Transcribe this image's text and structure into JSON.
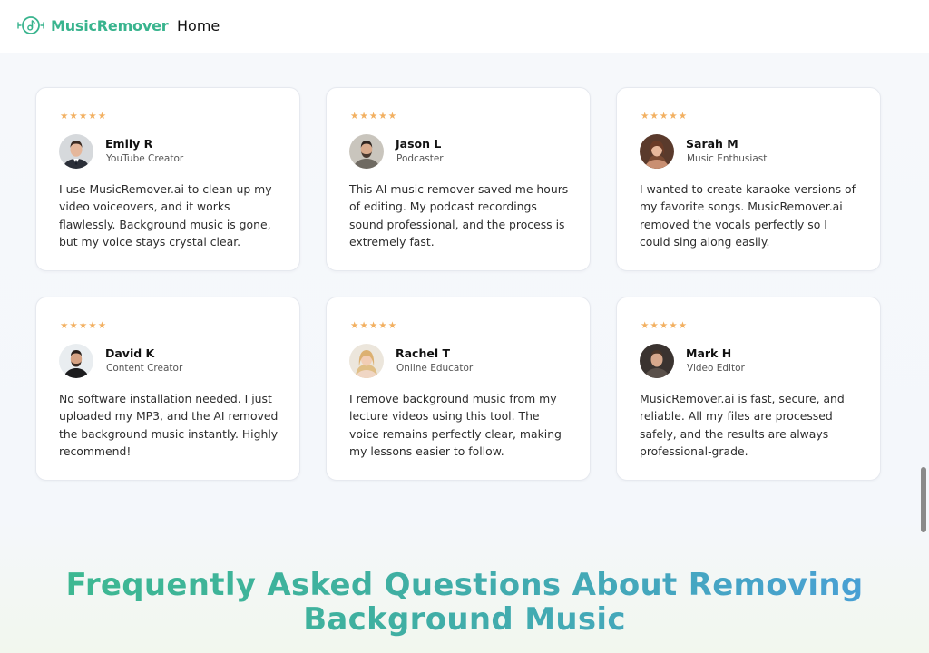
{
  "header": {
    "brand": "MusicRemover",
    "nav": {
      "home": "Home"
    },
    "brand_color": "#39b48e"
  },
  "testimonials": {
    "star_color": "#f2b061",
    "rating": 5,
    "items": [
      {
        "name": "Emily R",
        "role": "YouTube Creator",
        "quote": "I use MusicRemover.ai to clean up my video voiceovers, and it works flawlessly. Background music is gone, but my voice stays crystal clear."
      },
      {
        "name": "Jason L",
        "role": "Podcaster",
        "quote": "This AI music remover saved me hours of editing. My podcast recordings sound professional, and the process is extremely fast."
      },
      {
        "name": "Sarah M",
        "role": "Music Enthusiast",
        "quote": "I wanted to create karaoke versions of my favorite songs. MusicRemover.ai removed the vocals perfectly so I could sing along easily."
      },
      {
        "name": "David K",
        "role": "Content Creator",
        "quote": "No software installation needed. I just uploaded my MP3, and the AI removed the background music instantly. Highly recommend!"
      },
      {
        "name": "Rachel T",
        "role": "Online Educator",
        "quote": "I remove background music from my lecture videos using this tool. The voice remains perfectly clear, making my lessons easier to follow."
      },
      {
        "name": "Mark H",
        "role": "Video Editor",
        "quote": "MusicRemover.ai is fast, secure, and reliable. All my files are processed safely, and the results are always professional-grade."
      }
    ]
  },
  "faq": {
    "heading_line1": "Frequently Asked Questions About Removing",
    "heading_line2": "Background Music"
  }
}
